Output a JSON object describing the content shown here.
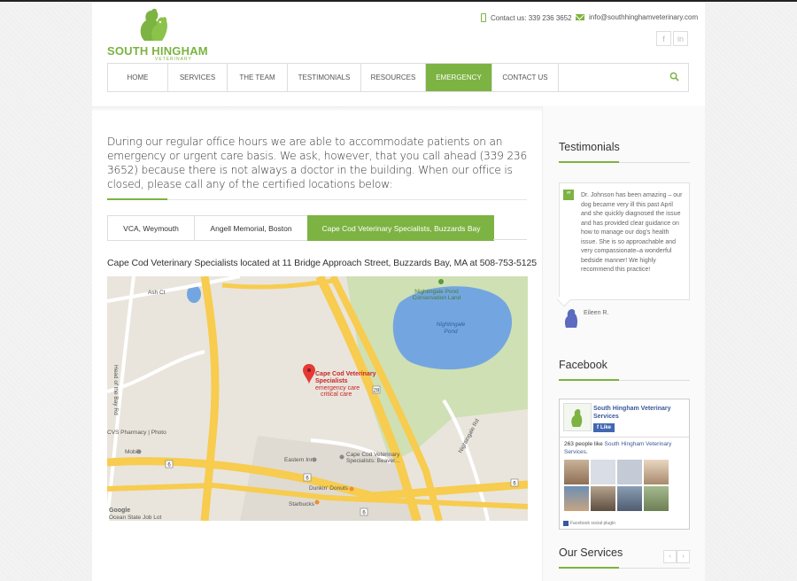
{
  "brand": {
    "name": "SOUTH HINGHAM",
    "sub": "VETERINARY",
    "color": "#7cb342"
  },
  "header": {
    "phone": "Contact us: 339 236 3652",
    "email": "info@southhinghamveterinary.com",
    "social": [
      {
        "icon": "facebook-icon",
        "label": "f"
      },
      {
        "icon": "linkedin-icon",
        "label": "in"
      }
    ]
  },
  "nav": {
    "items": [
      {
        "label": "HOME"
      },
      {
        "label": "SERVICES"
      },
      {
        "label": "THE TEAM"
      },
      {
        "label": "TESTIMONIALS"
      },
      {
        "label": "RESOURCES"
      },
      {
        "label": "EMERGENCY",
        "active": true
      },
      {
        "label": "CONTACT US"
      }
    ],
    "search_icon": "search-icon"
  },
  "main": {
    "intro": "During our regular office hours we are able to accommodate patients on an emergency or urgent care basis. We ask, however, that you call ahead (339 236 3652) because there is not always a doctor in the building. When our office is closed, please call any of the certified locations below:",
    "tabs": [
      {
        "label": "VCA, Weymouth"
      },
      {
        "label": "Angell Memorial, Boston"
      },
      {
        "label": "Cape Cod Veterinary Specialists, Buzzards Bay",
        "active": true
      }
    ],
    "location_text": "Cape Cod Veterinary Specialists located at 11 Bridge Approach Street, Buzzards Bay, MA at 508-753-5125",
    "map": {
      "labels": {
        "ash": "Ash Ct",
        "pond_area": "Nightingale Pond",
        "pond_area_2": "Conservation Land",
        "pond": "Nightingale",
        "pond_2": "Pond",
        "marker_title": "Cape Cod Veterinary",
        "marker_title_2": "Specialists",
        "marker_sub": "emergency care",
        "marker_sub_2": "critical care",
        "route_28": "28",
        "route_6a": "6",
        "route_6b": "6",
        "route_6c": "6",
        "route_6d": "6",
        "bay_rd": "Head of the Bay Rd",
        "nightingale_rd": "Nightingale Rd",
        "cvs": "CVS Pharmacy | Photo",
        "mobil": "Mobil",
        "eastern_inn": "Eastern Inn",
        "ccvs_small": "Cape Cod Veterinary",
        "ccvs_small_2": "Specialists: Beaver...",
        "dunkin": "Dunkin' Donuts",
        "starbucks": "Starbucks",
        "ocean_state": "Ocean State Job Lot",
        "google": "Google"
      }
    }
  },
  "sidebar": {
    "testimonials_title": "Testimonials",
    "testimonial_text": "Dr. Johnson has been amazing – our dog became very ill this past April and she quickly diagnosed the issue and has provided clear guidance on how to manage our dog's health issue. She is so approachable and very compassionate–a wonderful bedside manner! We highly recommend this practice!",
    "testimonial_author": "Eileen R.",
    "facebook_title": "Facebook",
    "fb_page_name": "South Hingham Veterinary Services",
    "fb_like": "Like",
    "fb_count_prefix": "263 people like ",
    "fb_count_link": "South Hingham Veterinary Services",
    "fb_count_suffix": ".",
    "fb_plugin": "Facebook social plugin",
    "services_title": "Our Services",
    "prev_label": "‹",
    "next_label": "›"
  }
}
